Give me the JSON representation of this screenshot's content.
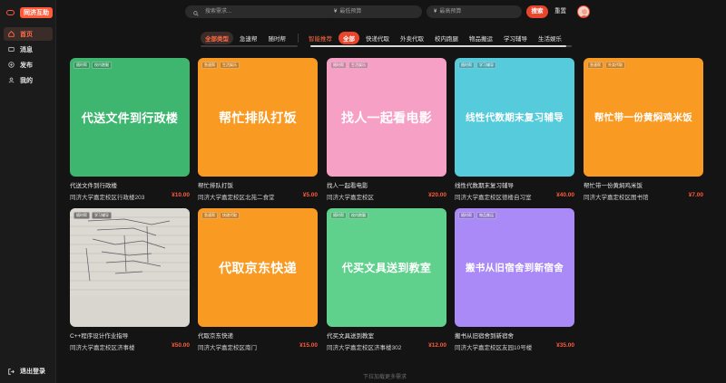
{
  "brand": {
    "name": "同济互助"
  },
  "nav": [
    {
      "label": "首页",
      "icon": "home-icon",
      "active": true
    },
    {
      "label": "消息",
      "icon": "message-icon",
      "active": false
    },
    {
      "label": "发布",
      "icon": "plus-circle-icon",
      "active": false
    },
    {
      "label": "我的",
      "icon": "user-icon",
      "active": false
    }
  ],
  "logout": {
    "label": "退出登录"
  },
  "search": {
    "placeholder": "搜索需求..."
  },
  "price_min": {
    "placeholder": "最低预算"
  },
  "price_max": {
    "placeholder": "最高预算"
  },
  "buttons": {
    "search": "搜索",
    "reset": "重置"
  },
  "filters": {
    "urgency": [
      "全部类型",
      "急速帮",
      "随时帮"
    ],
    "smart": "智能推荐",
    "categories": [
      "全部",
      "快递代取",
      "外卖代取",
      "校内跑腿",
      "物品搬运",
      "学习辅导",
      "生活娱乐"
    ]
  },
  "cards": [
    {
      "thumb_text": "代送文件到行政楼",
      "tags": [
        "随时帮",
        "校内跑腿"
      ],
      "color": "#3fb66f",
      "title": "代送文件到行政楼",
      "location": "同济大学嘉定校区行政楼203",
      "price": "¥10.00"
    },
    {
      "thumb_text": "帮忙排队打饭",
      "tags": [
        "急速帮",
        "生活娱乐"
      ],
      "color": "#f99a23",
      "title": "帮忙排队打饭",
      "location": "同济大学嘉定校区北苑二食堂",
      "price": "¥5.00"
    },
    {
      "thumb_text": "找人一起看电影",
      "tags": [
        "随时帮",
        "生活娱乐"
      ],
      "color": "#f7a0c6",
      "title": "找人一起看电影",
      "location": "同济大学嘉定校区",
      "price": "¥20.00"
    },
    {
      "thumb_text": "线性代数期末复习辅导",
      "tags": [
        "随时帮",
        "学习辅导"
      ],
      "color": "#56cbdc",
      "title": "线性代数期末复习辅导",
      "location": "同济大学嘉定校区德楼自习室",
      "price": "¥40.00"
    },
    {
      "thumb_text": "帮忙带一份黄焖鸡米饭",
      "tags": [
        "急速帮",
        "外卖代取"
      ],
      "color": "#f99a23",
      "title": "帮忙带一份黄焖鸡米饭",
      "location": "同济大学嘉定校区图书馆",
      "price": "¥7.00"
    },
    {
      "thumb_text": "",
      "tags": [
        "随时帮",
        "学习辅导"
      ],
      "color": "#d9d6cf",
      "title": "C++程序设计作业指导",
      "location": "同济大学嘉定校区济事楼",
      "price": "¥50.00"
    },
    {
      "thumb_text": "代取京东快递",
      "tags": [
        "急速帮",
        "快递代取"
      ],
      "color": "#f99a23",
      "title": "代取京东快递",
      "location": "同济大学嘉定校区南门",
      "price": "¥15.00"
    },
    {
      "thumb_text": "代买文具送到教室",
      "tags": [
        "随时帮",
        "校内跑腿"
      ],
      "color": "#5fd18c",
      "title": "代买文具送到教室",
      "location": "同济大学嘉定校区济事楼302",
      "price": "¥12.00"
    },
    {
      "thumb_text": "搬书从旧宿舍到新宿舍",
      "tags": [
        "随时帮",
        "物品搬运"
      ],
      "color": "#a98af7",
      "title": "搬书从旧宿舍到新宿舍",
      "location": "同济大学嘉定校区友园10号楼",
      "price": "¥35.00"
    }
  ],
  "footer": {
    "loadmore": "下拉加载更多需求"
  }
}
